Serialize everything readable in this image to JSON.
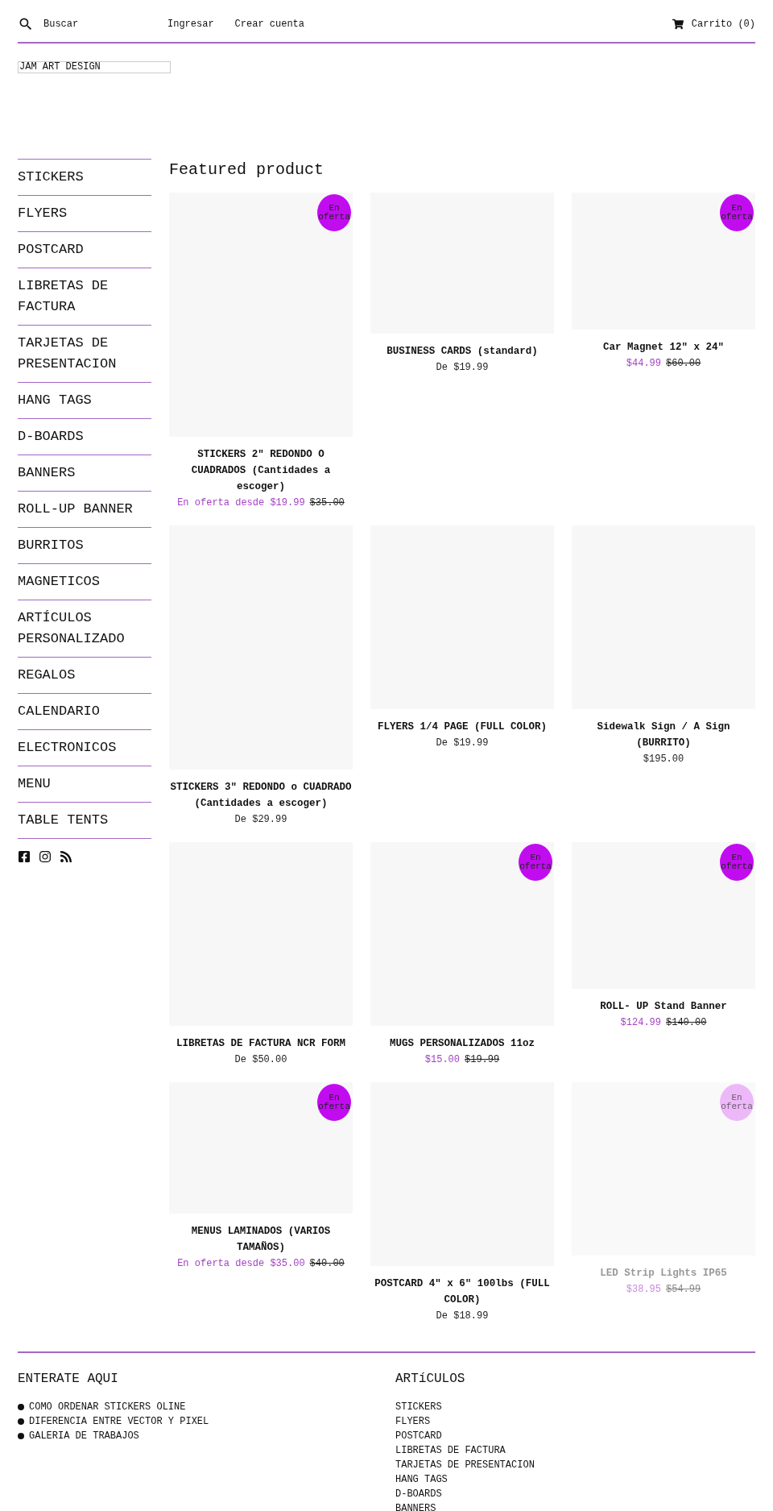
{
  "header": {
    "search_placeholder": "Buscar",
    "links": [
      "Ingresar",
      "Crear cuenta"
    ],
    "cart": "Carrito (0)"
  },
  "logo": "JAM ART DESIGN",
  "sidebar": {
    "items": [
      "STICKERS",
      "FLYERS",
      "POSTCARD",
      "LIBRETAS DE FACTURA",
      "TARJETAS DE PRESENTACION",
      "HANG TAGS",
      "D-BOARDS",
      "BANNERS",
      "ROLL-UP BANNER",
      "BURRITOS",
      "MAGNETICOS",
      "ARTÍCULOS PERSONALIZADO",
      "REGALOS",
      "CALENDARIO",
      "ELECTRONICOS",
      "MENU",
      "TABLE TENTS"
    ]
  },
  "section_title": "Featured product",
  "products": [
    {
      "title": "STICKERS 2\" REDONDO O CUADRADOS (Cantidades a escoger)",
      "badge": "En oferta",
      "on_sale": true,
      "price": "En oferta desde $19.99",
      "compare_price": "$35.00",
      "faded": false
    },
    {
      "title": "BUSINESS CARDS (standard)",
      "on_sale": false,
      "price": "De $19.99",
      "faded": false
    },
    {
      "title": "Car Magnet 12\" x 24\"",
      "badge": "En oferta",
      "on_sale": true,
      "price": "$44.99",
      "compare_price": "$60.00",
      "faded": false
    },
    {
      "title": "STICKERS 3\" REDONDO o CUADRADO (Cantidades a escoger)",
      "on_sale": false,
      "price": "De $29.99",
      "faded": false
    },
    {
      "title": "FLYERS 1/4 PAGE (FULL COLOR)",
      "on_sale": false,
      "price": "De $19.99",
      "faded": false
    },
    {
      "title": "Sidewalk Sign / A Sign (BURRITO)",
      "on_sale": false,
      "price": "$195.00",
      "faded": false
    },
    {
      "title": "LIBRETAS DE FACTURA NCR FORM",
      "on_sale": false,
      "price": "De $50.00",
      "faded": false
    },
    {
      "title": "MUGS PERSONALIZADOS 11oz",
      "badge": "En oferta",
      "on_sale": true,
      "price": "$15.00",
      "compare_price": "$19.99",
      "faded": false
    },
    {
      "title": "ROLL- UP Stand Banner",
      "badge": "En oferta",
      "on_sale": true,
      "price": "$124.99",
      "compare_price": "$140.00",
      "faded": false
    },
    {
      "title": "MENUS LAMINADOS (VARIOS TAMAÑOS)",
      "badge": "En oferta",
      "on_sale": true,
      "price": "En oferta desde $35.00",
      "compare_price": "$40.00",
      "faded": false
    },
    {
      "title": "POSTCARD 4\" x 6\" 100lbs (FULL COLOR)",
      "on_sale": false,
      "price": "De $18.99",
      "faded": false
    },
    {
      "title": "LED Strip Lights IP65",
      "badge": "En oferta",
      "on_sale": true,
      "price": "$38.95",
      "compare_price": "$54.99",
      "faded": true
    }
  ],
  "footer": {
    "columns": [
      {
        "title": "ENTERATE AQUI",
        "bulleted": true,
        "links": [
          "COMO ORDENAR STICKERS OLINE",
          "DIFERENCIA ENTRE VECTOR Y PIXEL",
          "GALERIA DE TRABAJOS"
        ]
      },
      {
        "title": "ARTíCULOS",
        "bulleted": false,
        "links": [
          "STICKERS",
          "FLYERS",
          "POSTCARD",
          "LIBRETAS DE FACTURA",
          "TARJETAS DE PRESENTACION",
          "HANG TAGS",
          "D-BOARDS",
          "BANNERS"
        ]
      }
    ]
  }
}
